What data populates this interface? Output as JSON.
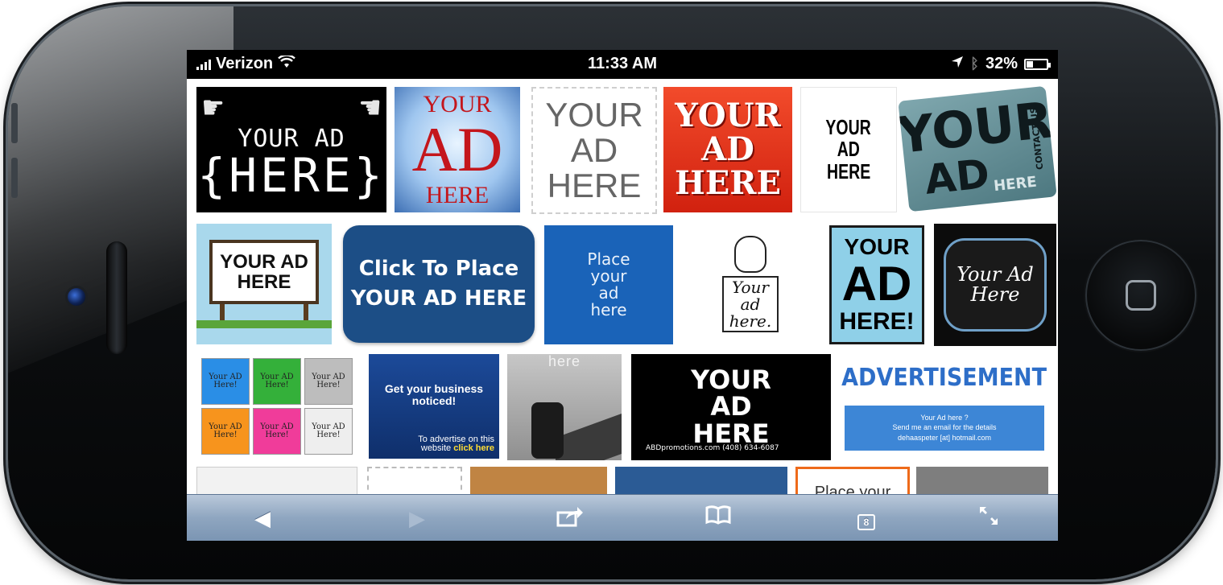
{
  "status_bar": {
    "carrier": "Verizon",
    "time": "11:33 AM",
    "battery": "32%",
    "battery_level": 0.32,
    "icons": [
      "signal-bars-icon",
      "wifi-icon",
      "location-arrow-icon",
      "bluetooth-icon",
      "battery-icon"
    ]
  },
  "ads": {
    "t1": {
      "line1": "YOUR AD",
      "line2": "{HERE}"
    },
    "t2": {
      "a": "YOUR",
      "b": "AD",
      "c": "HERE"
    },
    "t3": {
      "a": "YOUR",
      "b": "AD",
      "c": "HERE"
    },
    "t4": {
      "a": "YOUR",
      "b": "AD",
      "c": "HERE"
    },
    "t5": {
      "a": "YOUR",
      "b": "AD",
      "c": "HERE"
    },
    "t6": {
      "a": "YOUR",
      "b": "AD",
      "here": "HERE",
      "side": "CONTACT US"
    },
    "t7": {
      "a": "YOUR AD",
      "b": "HERE"
    },
    "t8": {
      "a": "Click To Place",
      "b": "YOUR AD HERE"
    },
    "t9": {
      "a": "Place",
      "b": "your",
      "c": "ad",
      "d": "here"
    },
    "t10": {
      "a": "Your",
      "b": "ad",
      "c": "here."
    },
    "t11": {
      "a": "YOUR",
      "b": "AD",
      "c": "HERE!"
    },
    "t12": {
      "a": "Your Ad",
      "b": "Here"
    },
    "t13": {
      "cells": [
        "Your AD Here!",
        "Your AD Here!",
        "Your AD Here!",
        "Your AD Here!",
        "Your AD Here!",
        "Your AD Here!"
      ]
    },
    "t14": {
      "headline": "Get your business noticed!",
      "foot1": "To advertise on this",
      "foot2": "website",
      "link": "click here"
    },
    "t15": {
      "here": "here"
    },
    "t16": {
      "a": "YOUR",
      "b": "AD",
      "c": "HERE",
      "foot": "ABDpromotions.com   (408) 634-6087"
    },
    "t17": {
      "title": "ADVERTISEMENT",
      "l1": "Your Ad here ?",
      "l2": "Send me an email for the details",
      "l3": "dehaaspeter [at] hotmail.com"
    },
    "r4e": "Place your"
  },
  "toolbar": {
    "back": "◀",
    "forward": "▶",
    "share": "⇪",
    "bookmarks": "📖",
    "tab_count": "8",
    "fullscreen": "⤢"
  },
  "colors": {
    "toolbar": "#8fa6c0",
    "status_bar": "#000000",
    "phone": "#0c0e10"
  }
}
